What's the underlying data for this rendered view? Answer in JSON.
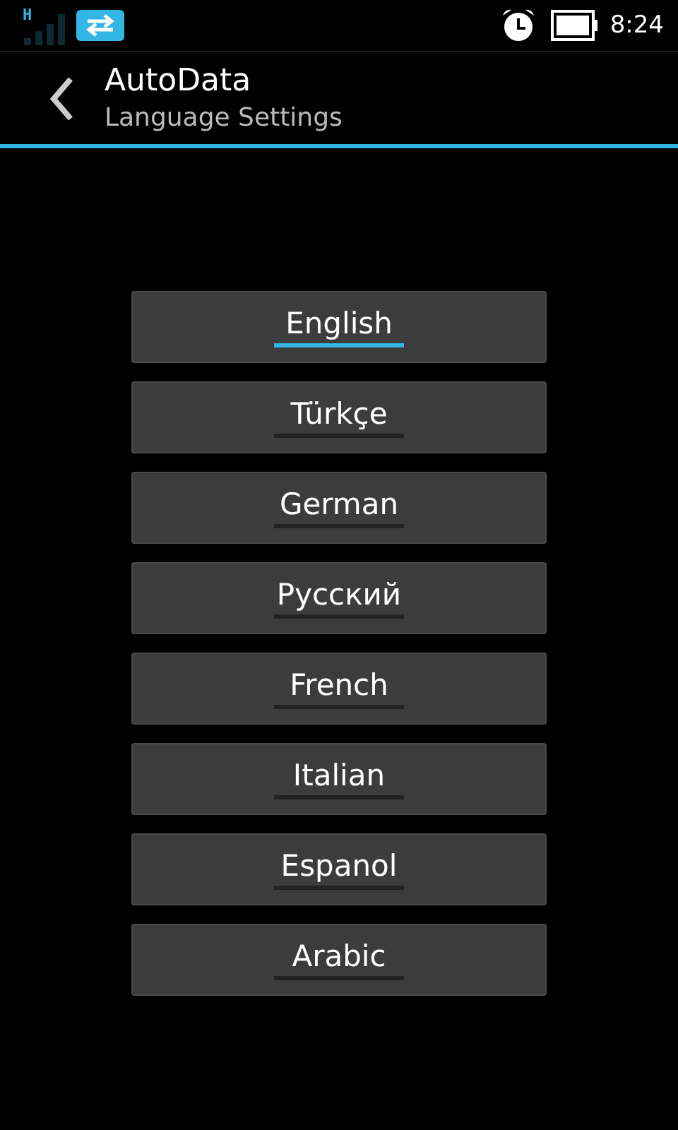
{
  "status_bar": {
    "network": "H",
    "time": "8:24"
  },
  "action_bar": {
    "title": "AutoData",
    "subtitle": "Language Settings"
  },
  "languages": [
    {
      "label": "English",
      "selected": true
    },
    {
      "label": "Türkçe",
      "selected": false
    },
    {
      "label": "German",
      "selected": false
    },
    {
      "label": "Русский",
      "selected": false
    },
    {
      "label": "French",
      "selected": false
    },
    {
      "label": "Italian",
      "selected": false
    },
    {
      "label": "Espanol",
      "selected": false
    },
    {
      "label": "Arabic",
      "selected": false
    }
  ]
}
